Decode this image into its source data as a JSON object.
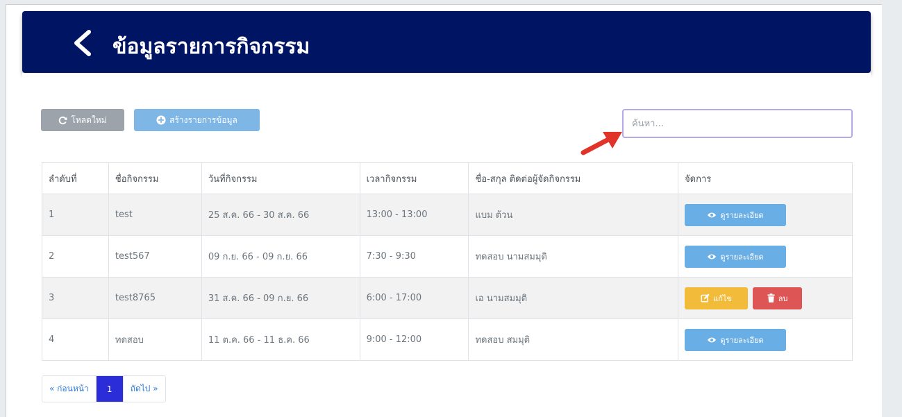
{
  "header": {
    "title": "ข้อมูลรายการกิจกรรม",
    "back_icon": "chevron-left-icon"
  },
  "toolbar": {
    "reload_label": "โหลดใหม่",
    "create_label": "สร้างรายการข้อมูล"
  },
  "search": {
    "placeholder": "ค้นหา..."
  },
  "table": {
    "headers": [
      "ลำดับที่",
      "ชื่อกิจกรรม",
      "วันที่กิจกรรม",
      "เวลากิจกรรม",
      "ชื่อ-สกุล ติดต่อผู้จัดกิจกรรม",
      "จัดการ"
    ],
    "rows": [
      {
        "no": "1",
        "name": "test",
        "date": "25 ส.ค. 66 - 30 ส.ค. 66",
        "time": "13:00 - 13:00",
        "contact": "แบม ต้วน"
      },
      {
        "no": "2",
        "name": "test567",
        "date": "09 ก.ย. 66 - 09 ก.ย. 66",
        "time": "7:30 - 9:30",
        "contact": "ทดสอบ นามสมมุติ"
      },
      {
        "no": "3",
        "name": "test8765",
        "date": "31 ส.ค. 66 - 09 ก.ย. 66",
        "time": "6:00 - 17:00",
        "contact": "เอ นามสมมุติ"
      },
      {
        "no": "4",
        "name": "ทดสอบ",
        "date": "11 ต.ค. 66 - 11 ธ.ค. 66",
        "time": "9:00 - 12:00",
        "contact": "ทดสอบ สมมุติ"
      }
    ],
    "actions": {
      "view_label": "ดูรายละเอียด",
      "edit_label": "แก้ไข",
      "delete_label": "ลบ"
    }
  },
  "pagination": {
    "prev": "« ก่อนหน้า",
    "current": "1",
    "next": "ถัดไป »"
  },
  "colors": {
    "header_bg": "#001464",
    "view_btn": "#6aaee6",
    "edit_btn": "#f3bb3a",
    "delete_btn": "#dd5554",
    "pager_active": "#2b2ed8",
    "annotation_arrow": "#e0342a"
  }
}
